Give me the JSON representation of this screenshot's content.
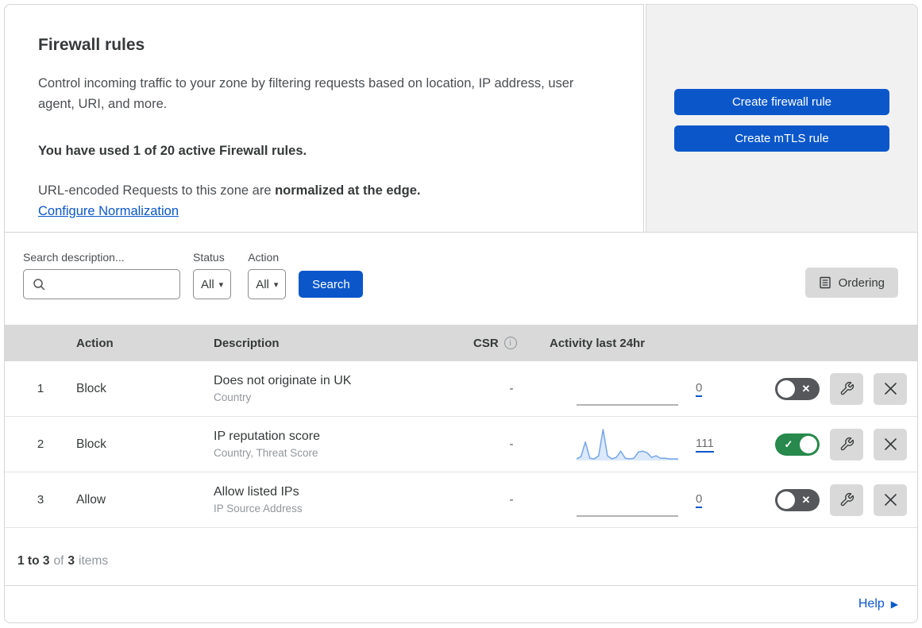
{
  "header": {
    "title": "Firewall rules",
    "description": "Control incoming traffic to your zone by filtering requests based on location, IP address, user agent, URI, and more.",
    "usage_bold": "You have used 1 of 20 active Firewall rules.",
    "normalization_text": "URL-encoded Requests to this zone are ",
    "normalization_bold": "normalized at the edge.",
    "normalization_link": "Configure Normalization",
    "create_firewall_button": "Create firewall rule",
    "create_mtls_button": "Create mTLS rule"
  },
  "filters": {
    "search_label": "Search description...",
    "search_value": "",
    "status_label": "Status",
    "status_value": "All",
    "action_label": "Action",
    "action_value": "All",
    "search_button": "Search",
    "ordering_button": "Ordering"
  },
  "table": {
    "columns": [
      "Action",
      "Description",
      "CSR",
      "Activity last 24hr"
    ],
    "rows": [
      {
        "priority": "1",
        "action": "Block",
        "description": "Does not originate in UK",
        "fields": "Country",
        "csr": "-",
        "activity_count": "0",
        "enabled": false,
        "activity_values": [
          0,
          0,
          0,
          0,
          0,
          0,
          0,
          0,
          0,
          0,
          0,
          0,
          0,
          0,
          0,
          0,
          0,
          0,
          0,
          0,
          0,
          0,
          0,
          0
        ]
      },
      {
        "priority": "2",
        "action": "Block",
        "description": "IP reputation score",
        "fields": "Country, Threat Score",
        "csr": "-",
        "activity_count": "111",
        "enabled": true,
        "activity_values": [
          2,
          5,
          24,
          3,
          2,
          6,
          40,
          6,
          2,
          4,
          12,
          3,
          2,
          3,
          11,
          12,
          10,
          4,
          6,
          3,
          3,
          2,
          2,
          2
        ]
      },
      {
        "priority": "3",
        "action": "Allow",
        "description": "Allow listed IPs",
        "fields": "IP Source Address",
        "csr": "-",
        "activity_count": "0",
        "enabled": false,
        "activity_values": [
          0,
          0,
          0,
          0,
          0,
          0,
          0,
          0,
          0,
          0,
          0,
          0,
          0,
          0,
          0,
          0,
          0,
          0,
          0,
          0,
          0,
          0,
          0,
          0
        ]
      }
    ]
  },
  "footer": {
    "range": "1 to 3",
    "of": "of",
    "total": "3",
    "items": "items",
    "help": "Help"
  },
  "colors": {
    "accent_blue": "#0b57ca",
    "toggle_on_green": "#27894c",
    "toggle_off_gray": "#55575b",
    "sparkline_stroke": "#76a5e8",
    "sparkline_fill": "#dce9fa",
    "flatline_gray": "#9a9a9a",
    "header_band": "#d9d9d9",
    "panel_gray": "#f1f1f2"
  }
}
